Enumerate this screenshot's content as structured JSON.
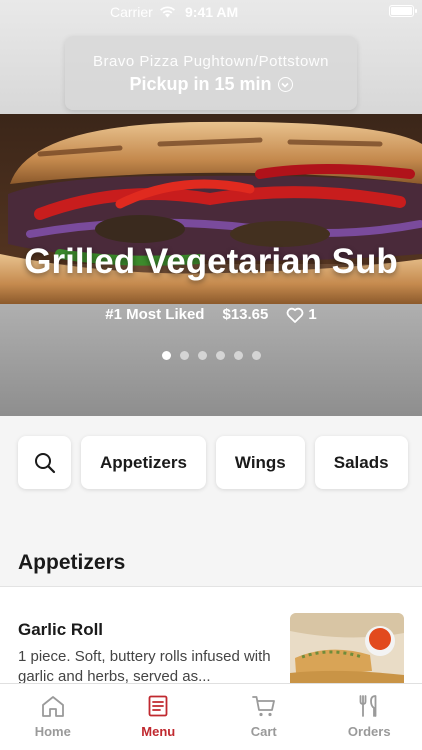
{
  "status_bar": {
    "carrier": "Carrier",
    "time": "9:41 AM"
  },
  "header": {
    "store_name": "Bravo Pizza Pughtown/Pottstown",
    "pickup": "Pickup in 15 min"
  },
  "hero": {
    "title": "Grilled Vegetarian Sub",
    "rank": "#1 Most Liked",
    "price": "$13.65",
    "likes": "1",
    "slides": 6,
    "active_slide": 0
  },
  "categories": {
    "items": [
      "Appetizers",
      "Wings",
      "Salads"
    ]
  },
  "section": {
    "title": "Appetizers"
  },
  "menu_item": {
    "name": "Garlic Roll",
    "description": "1 piece. Soft, buttery rolls infused with garlic and herbs, served as..."
  },
  "tabbar": {
    "items": [
      {
        "label": "Home",
        "icon": "home-icon"
      },
      {
        "label": "Menu",
        "icon": "menu-icon"
      },
      {
        "label": "Cart",
        "icon": "cart-icon"
      },
      {
        "label": "Orders",
        "icon": "orders-icon"
      }
    ],
    "active": "Menu"
  },
  "colors": {
    "accent": "#c0292f",
    "inactive": "#9a9a9a"
  }
}
